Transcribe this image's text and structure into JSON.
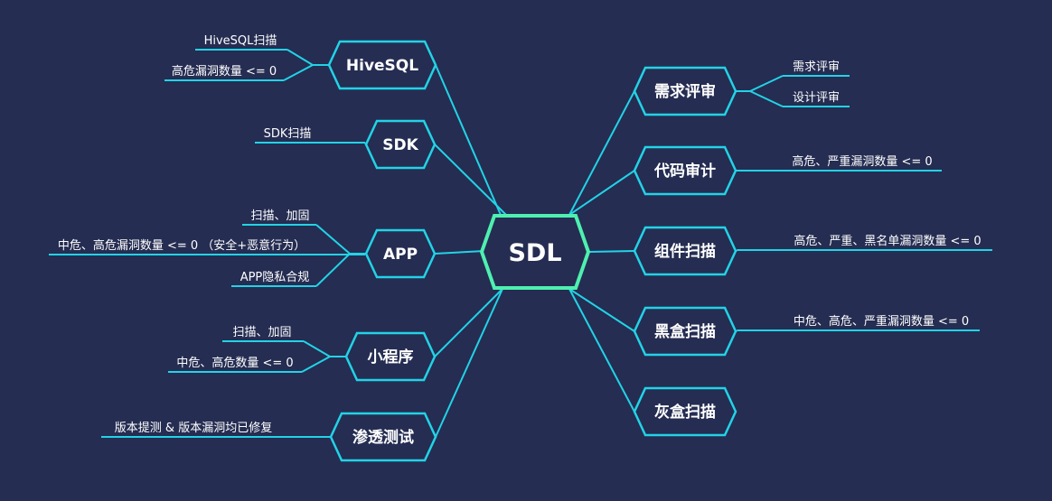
{
  "colors": {
    "background": "#252d52",
    "line": "#22d3e6",
    "center_border": "#4ef0b0"
  },
  "center": {
    "label": "SDL"
  },
  "branches": [
    {
      "label": "HiveSQL",
      "leaves": [
        "HiveSQL扫描",
        "高危漏洞数量 <= 0"
      ]
    },
    {
      "label": "SDK",
      "leaves": [
        "SDK扫描"
      ]
    },
    {
      "label": "APP",
      "leaves": [
        "扫描、加固",
        "中危、高危漏洞数量 <= 0 （安全+恶意行为）",
        "APP隐私合规"
      ]
    },
    {
      "label": "小程序",
      "leaves": [
        "扫描、加固",
        "中危、高危数量 <= 0"
      ]
    },
    {
      "label": "渗透测试",
      "leaves": [
        "版本提测 & 版本漏洞均已修复"
      ]
    },
    {
      "label": "需求评审",
      "leaves": [
        "需求评审",
        "设计评审"
      ]
    },
    {
      "label": "代码审计",
      "leaves": [
        "高危、严重漏洞数量 <= 0"
      ]
    },
    {
      "label": "组件扫描",
      "leaves": [
        "高危、严重、黑名单漏洞数量 <= 0"
      ]
    },
    {
      "label": "黑盒扫描",
      "leaves": [
        "中危、高危、严重漏洞数量 <= 0"
      ]
    },
    {
      "label": "灰盒扫描",
      "leaves": []
    }
  ]
}
